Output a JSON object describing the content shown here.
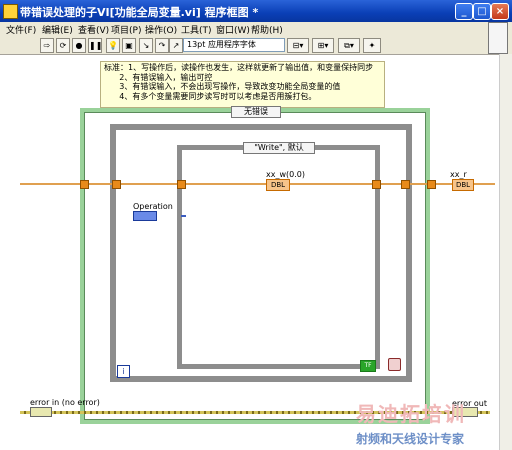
{
  "window": {
    "title": "带错误处理的子VI[功能全局变量.vi] 程序框图 *",
    "min_label": "_",
    "max_label": "□",
    "close_label": "×"
  },
  "menu": [
    "文件(F)",
    "编辑(E)",
    "查看(V)",
    "项目(P)",
    "操作(O)",
    "工具(T)",
    "窗口(W)",
    "帮助(H)"
  ],
  "toolbar": {
    "font": "13pt 应用程序字体"
  },
  "diagram": {
    "comment": "标准：1、写操作后，读操作也发生，这样就更新了输出值，和变量保持同步\n      2、有错误输入，输出可控\n      3、有错误输入，不会出现写操作，导致改变功能全局变量的值\n      4、有多个变量需要同步读写时可以考虑是否用簇打包。",
    "outer_case": "无错误",
    "inner_case": "\"Write\", 默认",
    "xx_w_label": "xx_w(0.0)",
    "xx_w_text": "DBL",
    "xx_r_label": "xx_r",
    "xx_r_text": "DBL",
    "operation_label": "Operation",
    "loop_index": "i",
    "error_in_label": "error in (no error)",
    "error_out_label": "error out",
    "tf_label": "TF"
  },
  "watermark": {
    "line1": "易迪拓培训",
    "line2": "射频和天线设计专家"
  },
  "colors": {
    "title": "#0a3fb6",
    "numeric_wire": "#e0a050",
    "loop_border": "#5a5a5a",
    "case_border": "#9ad29a"
  }
}
